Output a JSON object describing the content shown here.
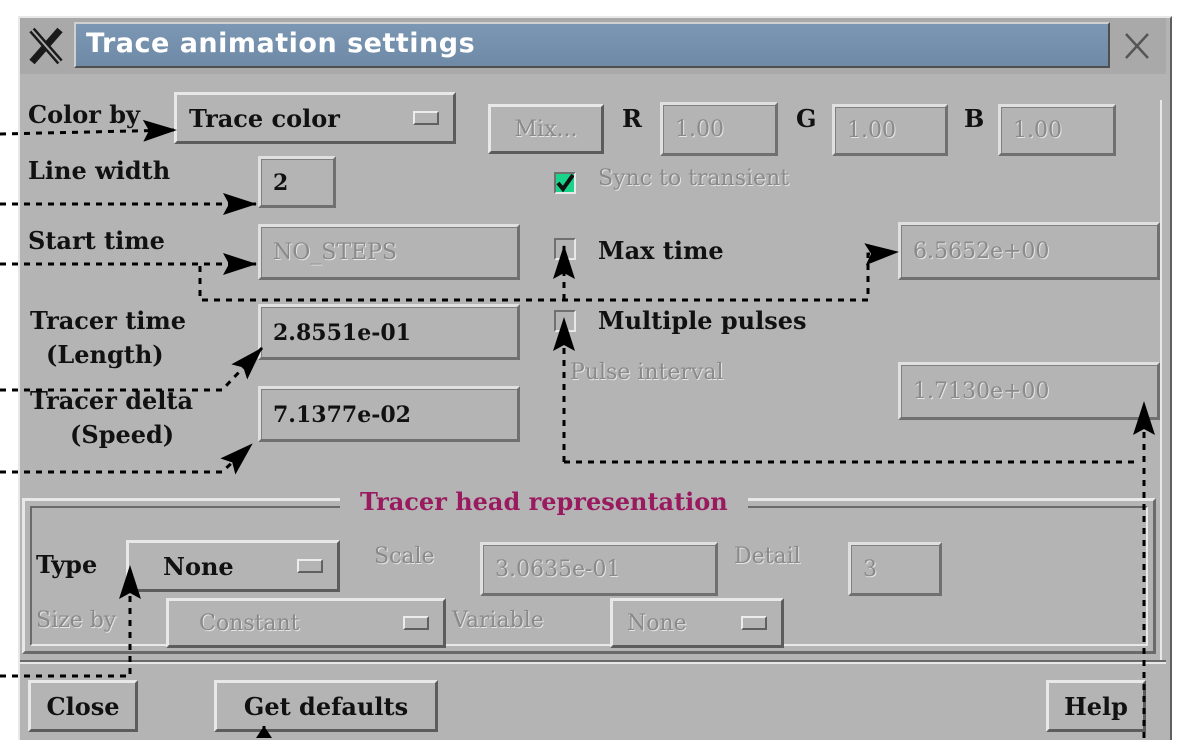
{
  "window": {
    "title": "Trace animation settings"
  },
  "color": {
    "label": "Color by",
    "option": "Trace color",
    "mix_label": "Mix...",
    "r_label": "R",
    "r_value": "1.00",
    "g_label": "G",
    "g_value": "1.00",
    "b_label": "B",
    "b_value": "1.00"
  },
  "line_width": {
    "label": "Line width",
    "value": "2"
  },
  "sync": {
    "label": "Sync to transient",
    "checked": true
  },
  "start_time": {
    "label": "Start time",
    "value": "NO_STEPS"
  },
  "max_time": {
    "label": "Max time",
    "value": "6.5652e+00",
    "checked": false
  },
  "tracer_time": {
    "label_line1": "Tracer time",
    "label_line2": "(Length)",
    "value": "2.8551e-01"
  },
  "multiple_pulses": {
    "label": "Multiple pulses",
    "checked": false
  },
  "tracer_delta": {
    "label_line1": "Tracer delta",
    "label_line2": "(Speed)",
    "value": "7.1377e-02"
  },
  "pulse_interval": {
    "label": "Pulse interval",
    "value": "1.7130e+00"
  },
  "head": {
    "title": "Tracer head representation",
    "type_label": "Type",
    "type_value": "None",
    "scale_label": "Scale",
    "scale_value": "3.0635e-01",
    "detail_label": "Detail",
    "detail_value": "3",
    "size_by_label": "Size by",
    "size_by_value": "Constant",
    "variable_label": "Variable",
    "variable_value": "None"
  },
  "buttons": {
    "close": "Close",
    "defaults": "Get defaults",
    "help": "Help"
  },
  "icons": {
    "window_menu": "x-logo-icon",
    "close": "close-x-icon",
    "check": "checkmark-icon"
  },
  "colors": {
    "title_bar": "#7b97b3",
    "panel": "#b4b4b4",
    "group_title": "#9a1a60",
    "check_on": "#19d38a"
  }
}
